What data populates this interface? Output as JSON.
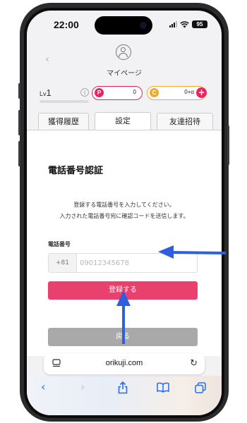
{
  "status": {
    "time": "22:00",
    "battery": "95"
  },
  "header": {
    "title": "マイページ"
  },
  "level": {
    "label": "Lv",
    "value": "1"
  },
  "currency": {
    "points": {
      "badge": "P",
      "value": "0"
    },
    "coins": {
      "badge": "C",
      "value": "0+α",
      "add": "+"
    }
  },
  "tabs": [
    {
      "label": "獲得履歴"
    },
    {
      "label": "設定"
    },
    {
      "label": "友達招待"
    }
  ],
  "phone_verify": {
    "title": "電話番号認証",
    "description_line1": "登録する電話番号を入力してください。",
    "description_line2": "入力された電話番号宛に確認コードを送信します。",
    "field_label": "電話番号",
    "country_code": "+81",
    "placeholder": "09012345678",
    "register_button": "登録する",
    "back_button": "戻る"
  },
  "browser": {
    "url": "orikuji.com"
  },
  "colors": {
    "accent": "#e8416e",
    "arrow": "#2f5fe0",
    "ios_blue": "#1f6ff2"
  }
}
